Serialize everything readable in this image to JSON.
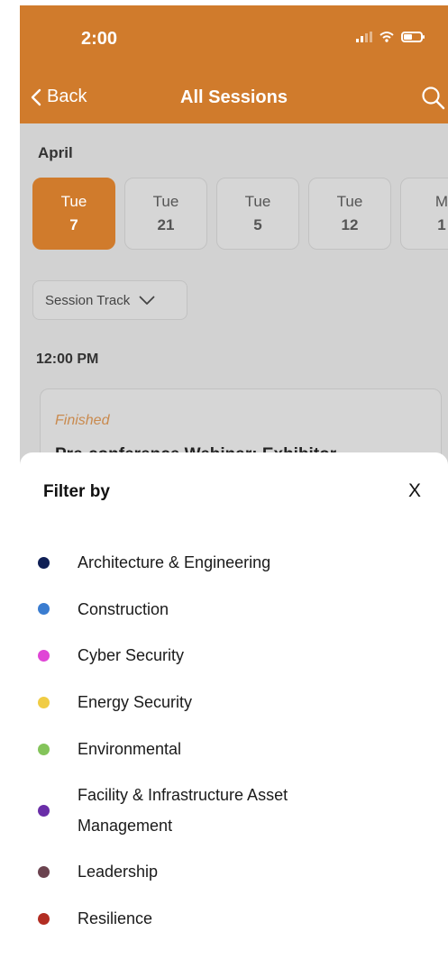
{
  "status_bar": {
    "time": "2:00"
  },
  "nav": {
    "back_label": "Back",
    "title": "All Sessions"
  },
  "month": "April",
  "dates": [
    {
      "dow": "Tue",
      "day": "7",
      "selected": true
    },
    {
      "dow": "Tue",
      "day": "21",
      "selected": false
    },
    {
      "dow": "Tue",
      "day": "5",
      "selected": false
    },
    {
      "dow": "Tue",
      "day": "12",
      "selected": false
    },
    {
      "dow": "M",
      "day": "1",
      "selected": false
    }
  ],
  "track_button": {
    "label": "Session Track"
  },
  "time_heading": "12:00 PM",
  "session": {
    "status": "Finished",
    "title": "Pre-conference Webinar: Exhibitor"
  },
  "filter_sheet": {
    "title": "Filter by",
    "close_label": "X",
    "items": [
      {
        "label": "Architecture & Engineering",
        "color": "#0f1f55"
      },
      {
        "label": "Construction",
        "color": "#3a7cd0"
      },
      {
        "label": "Cyber Security",
        "color": "#e045d6"
      },
      {
        "label": "Energy Security",
        "color": "#f0cc44"
      },
      {
        "label": "Environmental",
        "color": "#84c45a"
      },
      {
        "label": "Facility & Infrastructure Asset Management",
        "color": "#6a2ea8"
      },
      {
        "label": "Leadership",
        "color": "#6b434f"
      },
      {
        "label": "Resilience",
        "color": "#b22d22"
      }
    ]
  },
  "colors": {
    "accent": "#d07b2c"
  }
}
